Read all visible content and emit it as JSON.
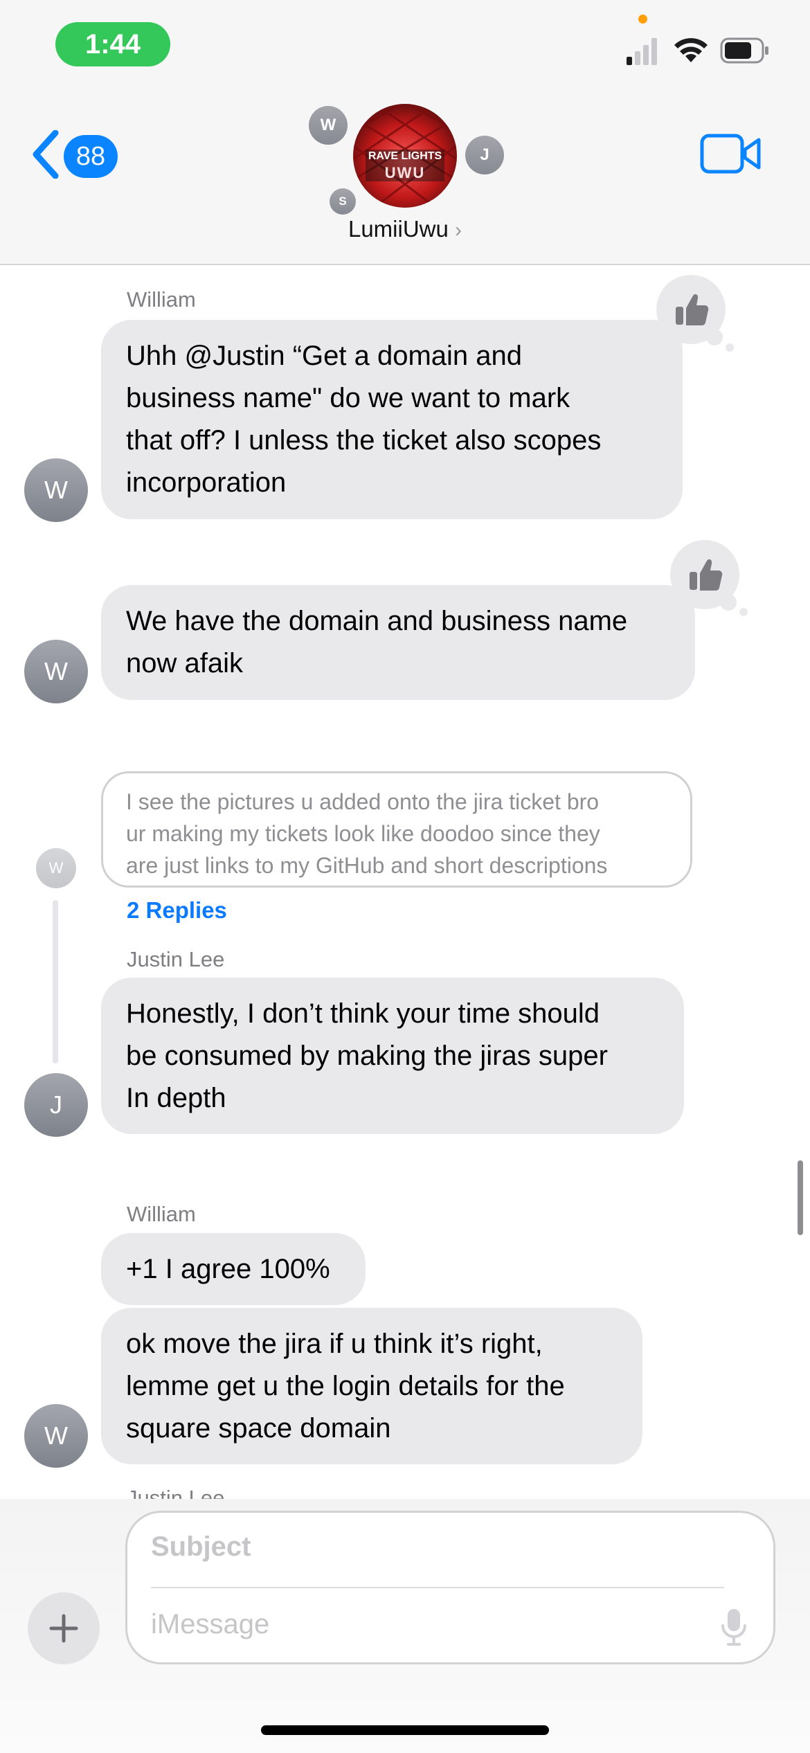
{
  "status_bar": {
    "time": "1:44"
  },
  "header": {
    "back_count": "88",
    "group_name": "LumiiUwu",
    "chevron": "›",
    "group_photo_lines": [
      "RAVE LIGHTS",
      "UWU"
    ],
    "member_initials": [
      "W",
      "J",
      "S"
    ],
    "accent_color": "#0a84ff"
  },
  "messages": [
    {
      "sender": "William",
      "lines": [
        "Uhh @Justin “Get a domain and",
        "business name\" do we want to mark",
        "that off? I unless the ticket also scopes",
        "incorporation"
      ],
      "avatar": "W",
      "tapback": "thumbs-up-icon"
    },
    {
      "lines": [
        "We have the domain and business name",
        "now afaik"
      ],
      "avatar": "W",
      "tapback": "thumbs-up-icon"
    },
    {
      "quoted_lines": [
        "I see the pictures u added onto the jira ticket bro",
        "ur making my tickets look like doodoo since they",
        "are just links to my GitHub and short descriptions"
      ],
      "quoted_avatar": "W",
      "replies": "2 Replies"
    },
    {
      "sender": "Justin Lee",
      "lines": [
        "Honestly, I don’t think your time should",
        "be consumed by making the jiras super",
        "In depth"
      ],
      "avatar": "J"
    },
    {
      "sender": "William",
      "lines": [
        "+1 I agree 100%"
      ]
    },
    {
      "lines": [
        "ok move the jira if u think it’s right,",
        "lemme get u the login details for the",
        "square space domain"
      ],
      "avatar": "W"
    },
    {
      "sender_cutoff": "Justin Lee"
    }
  ],
  "composer": {
    "subject_placeholder": "Subject",
    "message_placeholder": "iMessage",
    "plus": "+"
  }
}
